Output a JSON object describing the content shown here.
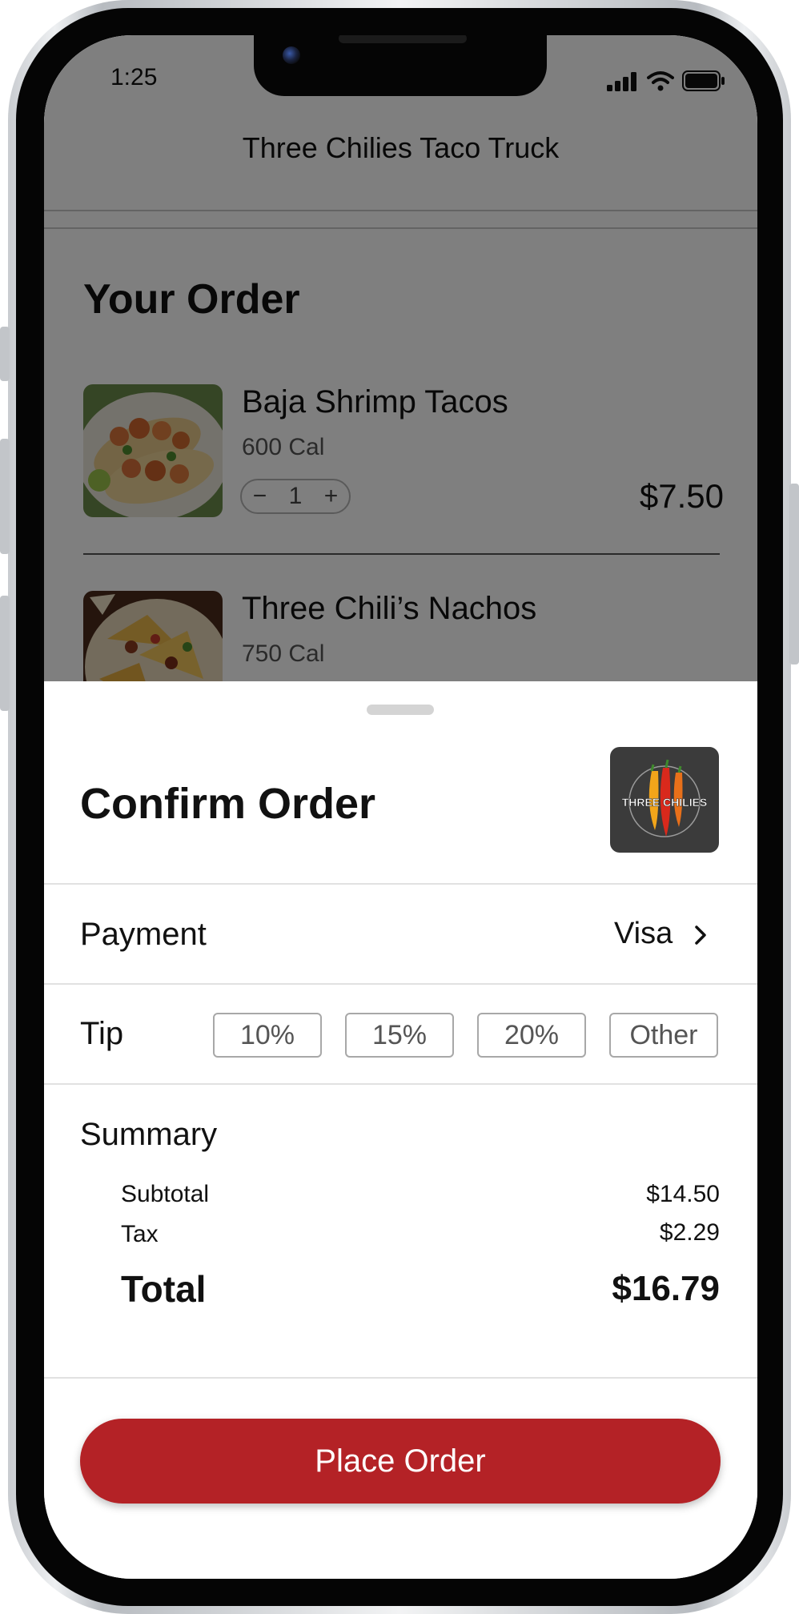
{
  "status_bar": {
    "time": "1:25"
  },
  "nav": {
    "title": "Three Chilies Taco Truck"
  },
  "order": {
    "heading": "Your Order",
    "items": [
      {
        "name": "Baja Shrimp Tacos",
        "calories": "600 Cal",
        "quantity": "1",
        "price": "$7.50",
        "minus": "−",
        "plus": "+"
      },
      {
        "name": "Three Chili’s Nachos",
        "calories": "750 Cal"
      }
    ]
  },
  "sheet": {
    "title": "Confirm Order",
    "logo_text": "THREE CHILIES",
    "payment": {
      "label": "Payment",
      "value": "Visa"
    },
    "tip": {
      "label": "Tip",
      "options": [
        "10%",
        "15%",
        "20%",
        "Other"
      ]
    },
    "summary": {
      "label": "Summary",
      "subtotal_label": "Subtotal",
      "subtotal": "$14.50",
      "tax_label": "Tax",
      "tax": "$2.29",
      "total_label": "Total",
      "total": "$16.79"
    },
    "place_order": "Place Order"
  },
  "colors": {
    "accent": "#b42226",
    "overlay": "rgba(0,0,0,0.5)"
  },
  "icons": [
    "signal-icon",
    "wifi-icon",
    "battery-icon",
    "chevron-right-icon",
    "grabber-handle",
    "chili-logo"
  ]
}
